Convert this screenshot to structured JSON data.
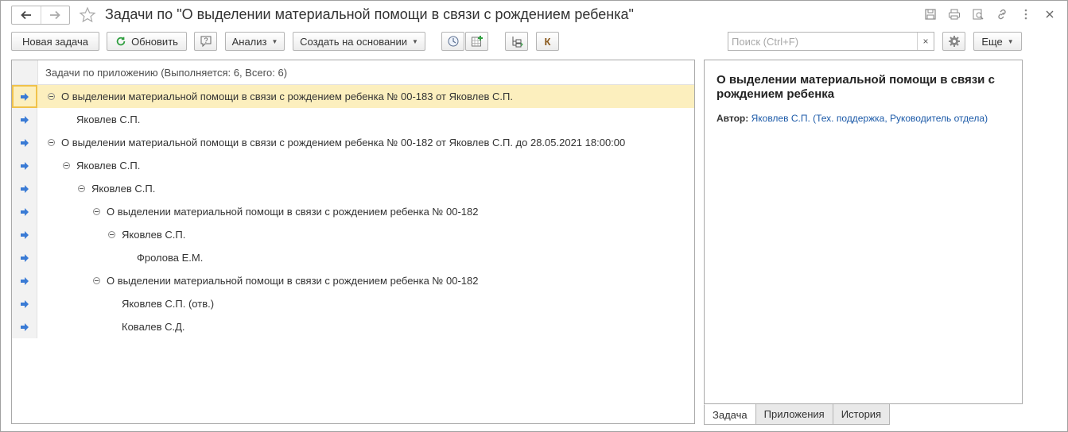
{
  "window": {
    "title": "Задачи по \"О выделении материальной помощи в связи с рождением ребенка\""
  },
  "toolbar": {
    "new_task": "Новая задача",
    "refresh": "Обновить",
    "analysis": "Анализ",
    "create_based_on": "Создать на основании",
    "k_label": "К",
    "more": "Еще",
    "search_placeholder": "Поиск (Ctrl+F)",
    "clear_symbol": "×"
  },
  "tree": {
    "header": "Задачи по приложению (Выполняется: 6, Всего: 6)",
    "rows": [
      {
        "text": "О выделении материальной помощи в связи с рождением ребенка № 00-183 от Яковлев С.П.",
        "level": 0,
        "toggle": true,
        "selected": true
      },
      {
        "text": "Яковлев С.П.",
        "level": 1,
        "toggle": false,
        "selected": false
      },
      {
        "text": "О выделении материальной помощи в связи с рождением ребенка № 00-182 от Яковлев С.П. до 28.05.2021 18:00:00",
        "level": 0,
        "toggle": true,
        "selected": false
      },
      {
        "text": "Яковлев С.П.",
        "level": 1,
        "toggle": true,
        "selected": false
      },
      {
        "text": "Яковлев С.П.",
        "level": 2,
        "toggle": true,
        "selected": false
      },
      {
        "text": "О выделении материальной помощи в связи с рождением ребенка №  00-182",
        "level": 3,
        "toggle": true,
        "selected": false
      },
      {
        "text": "Яковлев С.П.",
        "level": 4,
        "toggle": true,
        "selected": false
      },
      {
        "text": "Фролова Е.М.",
        "level": 5,
        "toggle": false,
        "selected": false
      },
      {
        "text": "О выделении материальной помощи в связи с рождением ребенка №  00-182",
        "level": 3,
        "toggle": true,
        "selected": false
      },
      {
        "text": "Яковлев С.П. (отв.)",
        "level": 4,
        "toggle": false,
        "selected": false
      },
      {
        "text": "Ковалев С.Д.",
        "level": 4,
        "toggle": false,
        "selected": false
      }
    ]
  },
  "detail": {
    "title": "О выделении материальной помощи в связи с рождением ребенка",
    "author_label": "Автор:",
    "author_value": "Яковлев С.П. (Тех. поддержка, Руководитель отдела)"
  },
  "tabs": [
    {
      "label": "Задача",
      "active": true
    },
    {
      "label": "Приложения",
      "active": false
    },
    {
      "label": "История",
      "active": false
    }
  ],
  "colors": {
    "selected_row": "#fcefbe",
    "selected_border": "#f0c24a",
    "arrow": "#3a7bd5",
    "link": "#1c5aa8",
    "refresh_green": "#2e9e3e"
  },
  "icons": {
    "back": "arrow-left-icon",
    "forward": "arrow-right-icon",
    "favorite": "star-icon",
    "save": "save-icon",
    "print": "print-icon",
    "preview": "search-doc-icon",
    "link": "link-icon",
    "menu": "more-vertical-icon",
    "close": "close-icon",
    "help": "help-icon",
    "clock": "clock-icon",
    "add_grid": "add-grid-icon",
    "tree_view": "tree-view-icon",
    "settings": "gear-icon",
    "row_marker": "arrow-right-blue-icon"
  }
}
